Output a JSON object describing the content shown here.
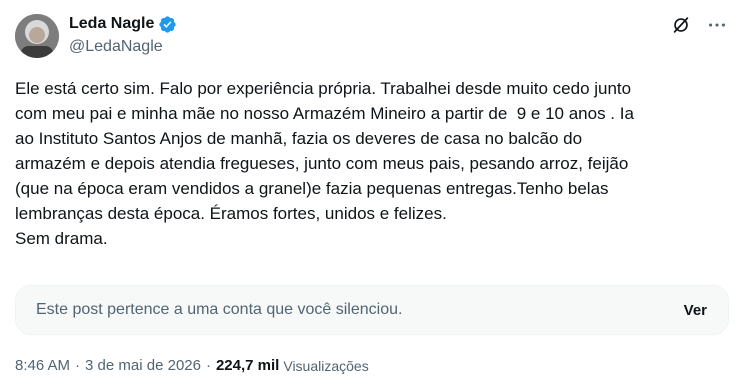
{
  "author": {
    "display_name": "Leda Nagle",
    "handle": "@LedaNagle",
    "verified_color": "#1d9bf0"
  },
  "actions": {
    "mute_icon": "muted-grok-icon",
    "more_icon": "more-options-icon"
  },
  "post": {
    "text": "Ele está certo sim. Falo por experiência própria. Trabalhei desde muito cedo junto\ncom meu pai e minha mãe no nosso Armazém Mineiro a partir de  9 e 10 anos . Ia\nao Instituto Santos Anjos de manhã, fazia os deveres de casa no balcão do\narmazém e depois atendia fregueses, junto com meus pais, pesando arroz, feijão\n(que na época eram vendidos a granel)e fazia pequenas entregas.Tenho belas\nlembranças desta época. Éramos fortes, unidos e felizes.\nSem drama."
  },
  "muted_notice": {
    "text": "Este post pertence a uma conta que você silenciou.",
    "button_label": "Ver"
  },
  "meta": {
    "time": "8:46 AM",
    "separator": "·",
    "date": "3 de mai de 2026",
    "views_count": "224,7 mil",
    "views_label": "Visualizações"
  }
}
